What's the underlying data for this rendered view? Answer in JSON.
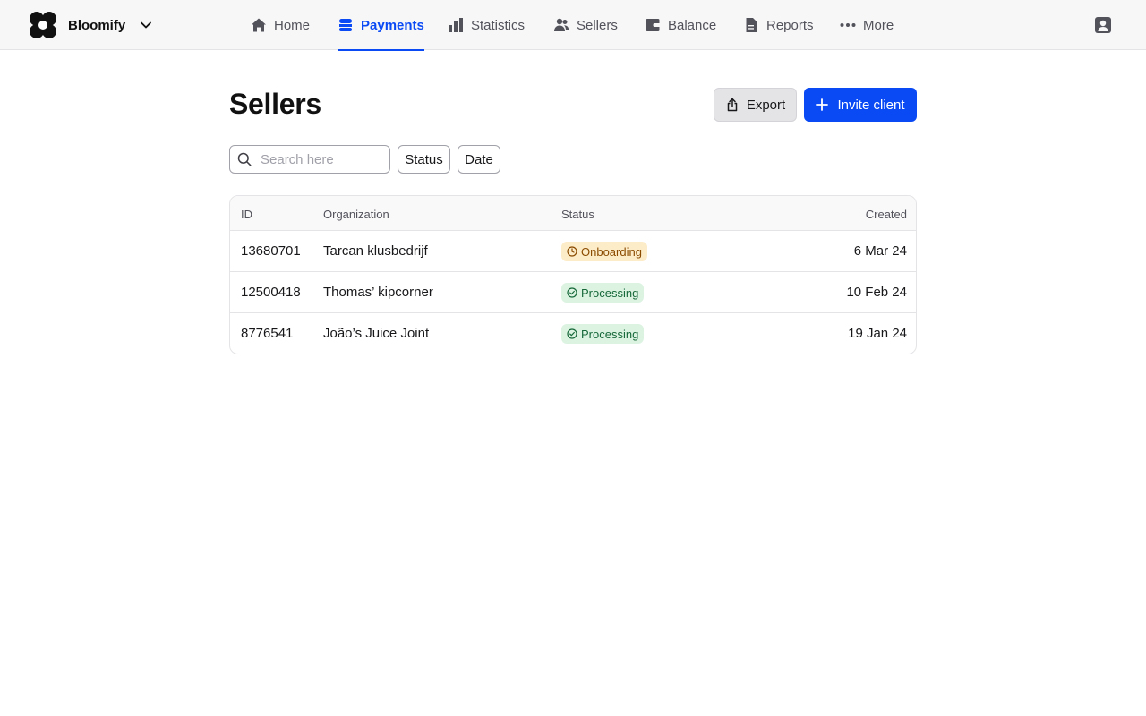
{
  "app": {
    "brand_name": "Bloomify",
    "accent_color": "#0a4af5"
  },
  "nav": {
    "items": [
      {
        "label": "Home",
        "icon": "home-icon",
        "active": false
      },
      {
        "label": "Payments",
        "icon": "payments-icon",
        "active": true
      },
      {
        "label": "Statistics",
        "icon": "bar-chart-icon",
        "active": false
      },
      {
        "label": "Sellers",
        "icon": "users-icon",
        "active": false
      },
      {
        "label": "Balance",
        "icon": "wallet-icon",
        "active": false
      },
      {
        "label": "Reports",
        "icon": "document-icon",
        "active": false
      },
      {
        "label": "More",
        "icon": "ellipsis-icon",
        "active": false
      }
    ]
  },
  "page": {
    "title": "Sellers",
    "export_label": "Export",
    "invite_label": "Invite client"
  },
  "filters": {
    "search_placeholder": "Search here",
    "search_value": "",
    "status_label": "Status",
    "date_label": "Date"
  },
  "table": {
    "columns": [
      "ID",
      "Organization",
      "Status",
      "Created"
    ],
    "rows": [
      {
        "id": "13680701",
        "organization": "Tarcan klusbedrijf",
        "status": "Onboarding",
        "status_kind": "onboarding",
        "created": "6 Mar 24"
      },
      {
        "id": "12500418",
        "organization": "Thomas’ kipcorner",
        "status": "Processing",
        "status_kind": "processing",
        "created": "10 Feb 24"
      },
      {
        "id": "8776541",
        "organization": "João’s Juice Joint",
        "status": "Processing",
        "status_kind": "processing",
        "created": "19 Jan 24"
      }
    ]
  },
  "status_colors": {
    "onboarding_bg": "#fdecc8",
    "onboarding_fg": "#8a4b00",
    "processing_bg": "#dcf3e2",
    "processing_fg": "#17693a"
  }
}
